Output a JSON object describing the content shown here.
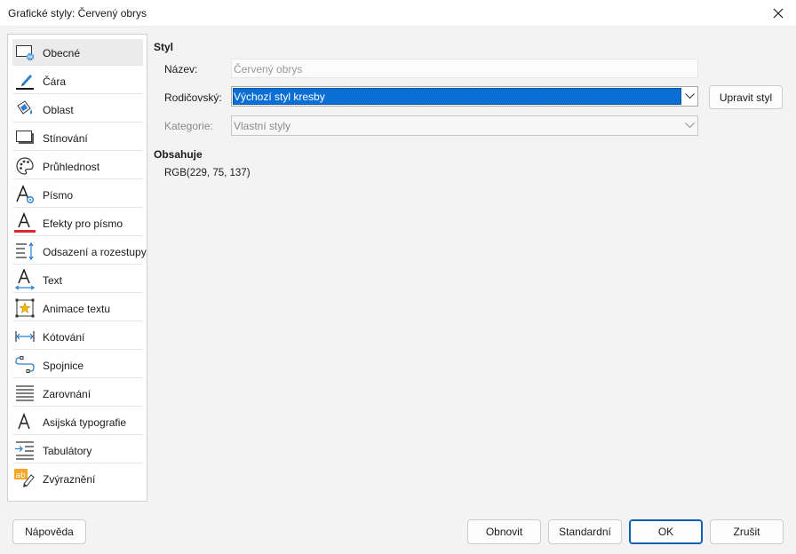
{
  "window": {
    "title": "Grafické styly: Červený obrys"
  },
  "sidebar": {
    "items": [
      {
        "label": "Obecné",
        "icon": "general-icon",
        "active": true
      },
      {
        "label": "Čára",
        "icon": "line-icon"
      },
      {
        "label": "Oblast",
        "icon": "area-fill-icon"
      },
      {
        "label": "Stínování",
        "icon": "shadow-icon"
      },
      {
        "label": "Průhlednost",
        "icon": "palette-icon"
      },
      {
        "label": "Písmo",
        "icon": "font-icon"
      },
      {
        "label": "Efekty pro písmo",
        "icon": "font-effects-icon"
      },
      {
        "label": "Odsazení a rozestupy",
        "icon": "indent-spacing-icon"
      },
      {
        "label": "Text",
        "icon": "text-icon"
      },
      {
        "label": "Animace textu",
        "icon": "text-animation-icon"
      },
      {
        "label": "Kótování",
        "icon": "dimension-icon"
      },
      {
        "label": "Spojnice",
        "icon": "connector-icon"
      },
      {
        "label": "Zarovnání",
        "icon": "alignment-icon"
      },
      {
        "label": "Asijská typografie",
        "icon": "asian-typography-icon"
      },
      {
        "label": "Tabulátory",
        "icon": "tabs-icon"
      },
      {
        "label": "Zvýraznění",
        "icon": "highlight-icon"
      }
    ]
  },
  "style_section": {
    "title": "Styl",
    "name_label": "Název:",
    "name_value": "Červený obrys",
    "parent_label": "Rodičovský:",
    "parent_value": "Výchozí styl kresby",
    "edit_style_label": "Upravit styl",
    "category_label": "Kategorie:",
    "category_value": "Vlastní styly"
  },
  "contains_section": {
    "title": "Obsahuje",
    "value": "RGB(229, 75, 137)"
  },
  "footer": {
    "help_label": "Nápověda",
    "reset_label": "Obnovit",
    "standard_label": "Standardní",
    "ok_label": "OK",
    "cancel_label": "Zrušit"
  },
  "colors": {
    "accent": "#0a6fd4",
    "font_effect_underline": "#e0242b",
    "icon_blue": "#2a7fd4"
  }
}
